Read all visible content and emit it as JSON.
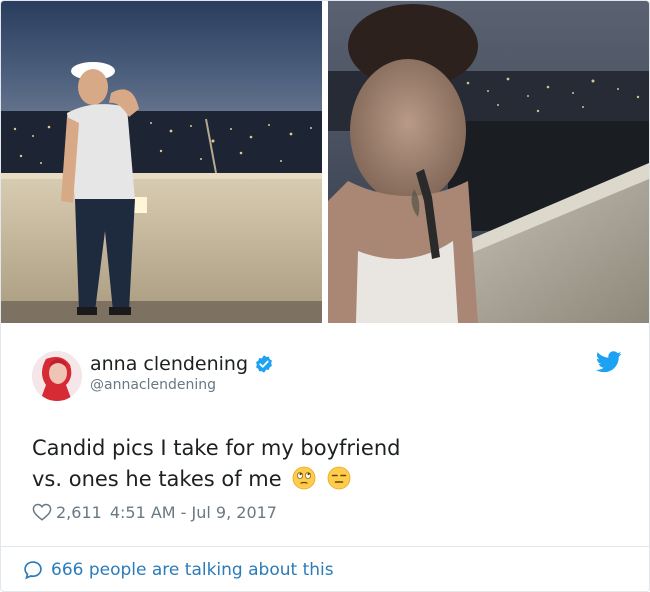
{
  "tweet": {
    "author": {
      "name": "anna clendening",
      "handle": "@annaclendening",
      "verified": true
    },
    "text_line1": "Candid pics I take for my boyfriend",
    "text_line2": "vs. ones he takes of me",
    "emojis": [
      "face-with-rolling-eyes",
      "expressionless-face"
    ],
    "likes": "2,611",
    "timestamp": "4:51 AM - Jul 9, 2017",
    "conversation_link": "666 people are talking about this"
  },
  "colors": {
    "link_blue": "#2b7bb9",
    "twitter_blue": "#1da1f2",
    "text": "#1c2022",
    "muted": "#697882",
    "border": "#e1e8ed"
  },
  "icons": {
    "verified": "verified-badge-icon",
    "brand": "twitter-bird-icon",
    "like": "heart-icon",
    "conversation": "speech-bubble-icon"
  }
}
